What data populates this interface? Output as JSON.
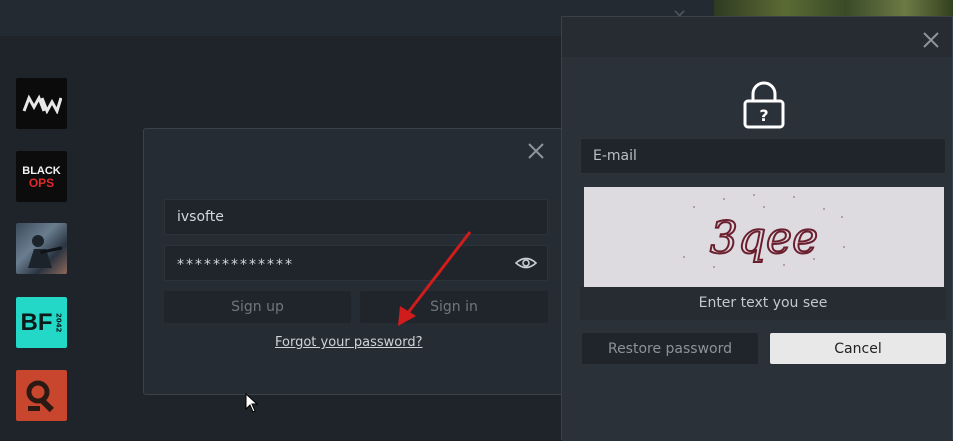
{
  "games": [
    {
      "name": "MW"
    },
    {
      "name": "BLACK OPS"
    },
    {
      "name": "Soldier"
    },
    {
      "name": "BF 2042"
    },
    {
      "name": "Rust"
    }
  ],
  "login": {
    "username": "ivsofte",
    "password_masked": "*************",
    "signup_label": "Sign up",
    "signin_label": "Sign in",
    "forgot_label": "Forgot your password?"
  },
  "restore": {
    "email_placeholder": "E-mail",
    "captcha_text": "3qee",
    "captcha_hint": "Enter text you see",
    "restore_label": "Restore password",
    "cancel_label": "Cancel"
  },
  "colors": {
    "arrow": "#d11c1c",
    "accent_bf": "#24d8c8",
    "accent_rust": "#c8452e"
  }
}
